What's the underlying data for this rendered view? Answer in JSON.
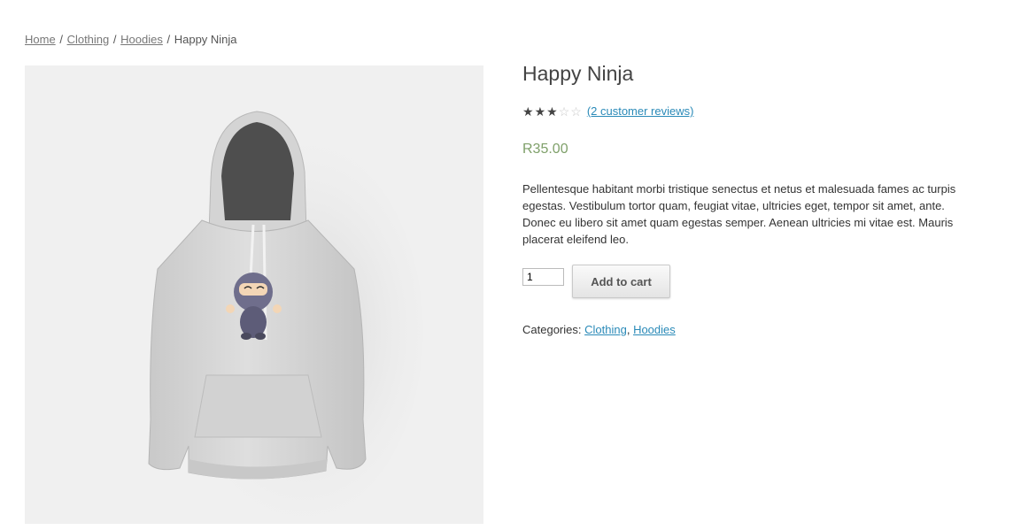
{
  "breadcrumb": {
    "items": [
      "Home",
      "Clothing",
      "Hoodies"
    ],
    "separator": "/",
    "current": "Happy Ninja"
  },
  "product": {
    "title": "Happy Ninja",
    "rating": 3,
    "rating_max": 5,
    "reviews_link": "(2 customer reviews)",
    "price": "R35.00",
    "description": "Pellentesque habitant morbi tristique senectus et netus et malesuada fames ac turpis egestas. Vestibulum tortor quam, feugiat vitae, ultricies eget, tempor sit amet, ante. Donec eu libero sit amet quam egestas semper. Aenean ultricies mi vitae est. Mauris placerat eleifend leo.",
    "quantity": "1",
    "add_to_cart_label": "Add to cart",
    "categories_label": "Categories:",
    "categories": [
      "Clothing",
      "Hoodies"
    ],
    "categories_separator": ","
  },
  "colors": {
    "price": "#7fa06a",
    "link": "#2a8ab8",
    "image_background": "#f0f0f0"
  },
  "icons": [
    "star-full-icon",
    "star-empty-icon"
  ]
}
